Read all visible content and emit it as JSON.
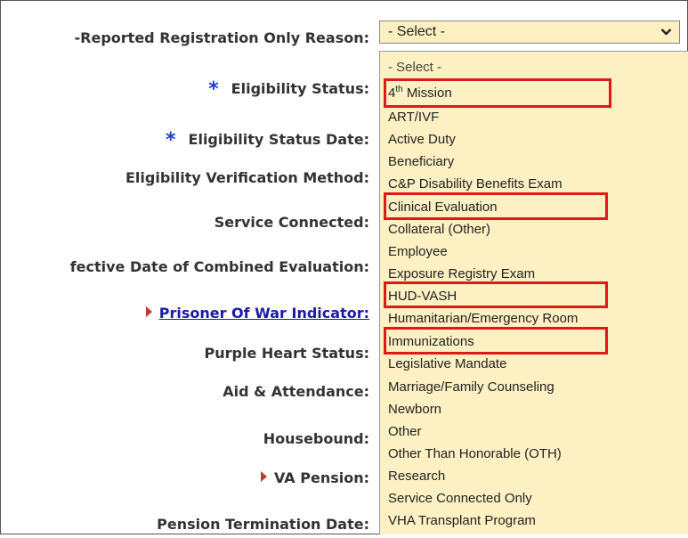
{
  "form": {
    "labels": {
      "registration_reason": "-Reported Registration Only Reason:",
      "eligibility_status": "Eligibility Status:",
      "eligibility_status_date": "Eligibility Status Date:",
      "eligibility_verification": "Eligibility Verification Method:",
      "service_connected": "Service Connected:",
      "effective_date": "fective Date of Combined Evaluation:",
      "prisoner_of_war": "Prisoner Of War Indicator:",
      "purple_heart": "Purple Heart Status:",
      "aid_attendance": "Aid & Attendance:",
      "housebound": "Housebound:",
      "va_pension": "VA Pension:",
      "pension_termination": "Pension Termination Date:"
    },
    "required_marker": "*"
  },
  "select": {
    "value": "- Select -",
    "chevron": "❯"
  },
  "dropdown": {
    "first_option": "- Select -",
    "mission_sup": "th",
    "mission_prefix": "4",
    "mission_rest": " Mission",
    "options": [
      "ART/IVF",
      "Active Duty",
      "Beneficiary",
      "C&P Disability Benefits Exam",
      "Clinical Evaluation",
      "Collateral (Other)",
      "Employee",
      "Exposure Registry Exam",
      "HUD-VASH",
      "Humanitarian/Emergency Room",
      "Immunizations",
      "Legislative Mandate",
      "Marriage/Family Counseling",
      "Newborn",
      "Other",
      "Other Than Honorable (OTH)",
      "Research",
      "Service Connected Only",
      "VHA Transplant Program"
    ],
    "highlighted": [
      "4th Mission",
      "Clinical Evaluation",
      "HUD-VASH",
      "Immunizations"
    ],
    "highlight_color": "#e01818",
    "background": "#fdf0c2"
  }
}
